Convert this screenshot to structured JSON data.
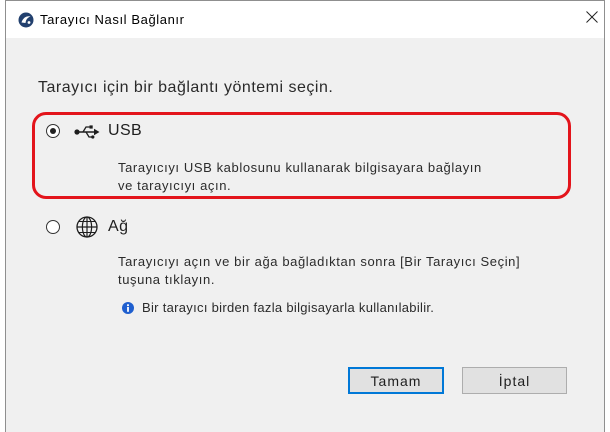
{
  "window": {
    "title": "Tarayıcı Nasıl Bağlanır",
    "app_icon": "scanner-app-icon",
    "close_icon": "close-icon"
  },
  "instruction": "Tarayıcı için bir bağlantı yöntemi seçin.",
  "options": [
    {
      "label": "USB",
      "icon": "usb-icon",
      "selected": true,
      "description": [
        "Tarayıcıyı USB kablosunu kullanarak bilgisayara bağlayın",
        "ve tarayıcıyı açın."
      ]
    },
    {
      "label": "Ağ",
      "icon": "globe-icon",
      "selected": false,
      "description": [
        "Tarayıcıyı açın ve bir ağa bağladıktan sonra [Bir Tarayıcı Seçin]",
        "tuşuna tıklayın."
      ],
      "note": {
        "icon": "info-icon",
        "text": "Bir tarayıcı birden fazla bilgisayarla kullanılabilir."
      }
    }
  ],
  "buttons": {
    "ok": {
      "label": "Tamam",
      "default": true
    },
    "cancel": {
      "label": "İptal",
      "default": false
    }
  },
  "colors": {
    "highlight": "#e3141b",
    "accent": "#0078d7",
    "info": "#1f5fcf",
    "app_icon": "#22406e"
  }
}
